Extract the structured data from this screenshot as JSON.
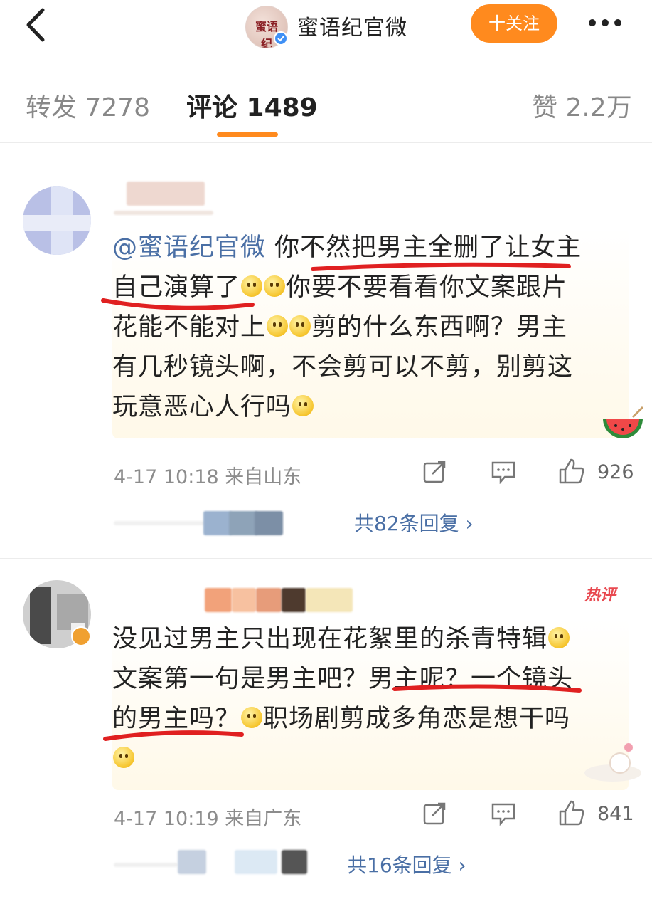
{
  "header": {
    "account_name": "蜜语纪官微",
    "avatar_logo_text": "蜜语纪",
    "follow_label": "十关注"
  },
  "tabs": [
    {
      "label": "转发 7278",
      "active": false
    },
    {
      "label": "评论 1489",
      "active": true
    },
    {
      "label": "赞 2.2万",
      "active": false
    }
  ],
  "colors": {
    "accent": "#ff8a1e",
    "link": "#4a6fa5",
    "underline": "#e02020",
    "hot": "#e8484f"
  },
  "comments": [
    {
      "mention": "@蜜语纪官微",
      "lines": [
        "你不然把男主全删了让女主",
        "自己演算了",
        "你要不要看看你文案跟片",
        "花能不能对上",
        "剪的什么东西啊？男主",
        "有几秒镜头啊，不会剪可以不剪，别剪这",
        "玩意恶心人行吗"
      ],
      "time": "4-17 10:18",
      "source": "来自山东",
      "likes": "926",
      "replies": "共82条回复 ›"
    },
    {
      "hot_label": "热评",
      "lines": [
        "没见过男主只出现在花絮里的杀青特辑",
        "文案第一句是男主吧？男主呢？一个镜头",
        "的男主吗？",
        "职场剧剪成多角恋是想干吗"
      ],
      "time": "4-17 10:19",
      "source": "来自广东",
      "likes": "841",
      "replies": "共16条回复 ›"
    }
  ]
}
